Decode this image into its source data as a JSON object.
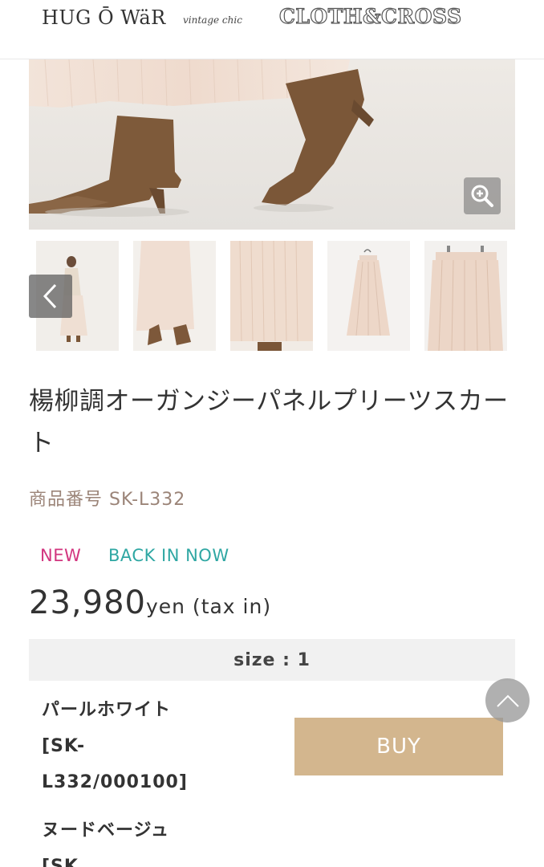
{
  "header": {
    "logo_hug": "HUG Ō WäR",
    "logo_vintage": "vintage chic",
    "logo_cloth": "CLOTH&CROSS"
  },
  "icons": {
    "zoom": "zoom-in-icon",
    "prev": "chevron-left-icon",
    "scroll_top": "chevron-up-icon"
  },
  "product": {
    "title": "楊柳調オーガンジーパネルプリーツスカート",
    "code": "商品番号 SK-L332",
    "badge_new": "NEW",
    "badge_back": "BACK IN NOW",
    "price_number": "23,980",
    "price_unit": "yen (tax in)"
  },
  "size": {
    "label": "size : 1"
  },
  "variants": [
    {
      "name": "パールホワイト\n[SK-\nL332/000100]"
    },
    {
      "name": "ヌードベージュ\n[SK"
    }
  ],
  "buy_label": "BUY",
  "colors": {
    "accent_buy": "#d3b68e",
    "badge_new": "#d2357f",
    "badge_back": "#2fa7a3",
    "code_text": "#9b8478"
  }
}
